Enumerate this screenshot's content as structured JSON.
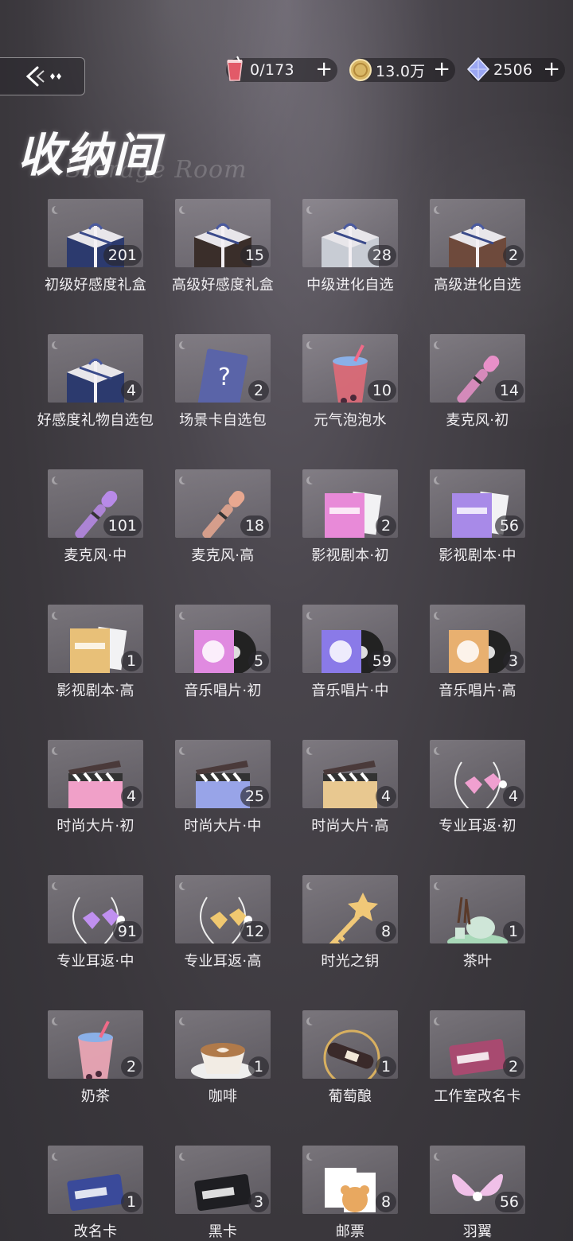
{
  "header": {
    "title": "收纳间",
    "subtitle": "Storage Room",
    "back_icon": "back-arrow-icon"
  },
  "resources": [
    {
      "icon": "drink-icon",
      "value": "0/173",
      "color": "#e05a6a"
    },
    {
      "icon": "gold-coin-icon",
      "value": "13.0万",
      "color": "#e8c87a"
    },
    {
      "icon": "diamond-icon",
      "value": "2506",
      "color": "#9aa6f2"
    }
  ],
  "items": [
    {
      "name": "初级好感度礼盒",
      "count": "201",
      "icon": "gift-box-blue-icon",
      "color": "#2c3a6e"
    },
    {
      "name": "高级好感度礼盒",
      "count": "15",
      "icon": "gift-set-premium-icon",
      "color": "#3a2e2a"
    },
    {
      "name": "中级进化自选",
      "count": "28",
      "icon": "box-silver-icon",
      "color": "#c8ccd4"
    },
    {
      "name": "高级进化自选",
      "count": "2",
      "icon": "box-brown-icon",
      "color": "#6e4a3c"
    },
    {
      "name": "好感度礼物自选包",
      "count": "4",
      "icon": "gift-box-blue-icon",
      "color": "#2c3a6e"
    },
    {
      "name": "场景卡自选包",
      "count": "2",
      "icon": "scene-card-icon",
      "color": "#5a64a8"
    },
    {
      "name": "元气泡泡水",
      "count": "10",
      "icon": "bubble-drink-icon",
      "color": "#e06a78"
    },
    {
      "name": "麦克风·初",
      "count": "14",
      "icon": "microphone-pink-icon",
      "color": "#e890c8"
    },
    {
      "name": "麦克风·中",
      "count": "101",
      "icon": "microphone-purple-icon",
      "color": "#b88ae8"
    },
    {
      "name": "麦克风·高",
      "count": "18",
      "icon": "microphone-peach-icon",
      "color": "#e8a890"
    },
    {
      "name": "影视剧本·初",
      "count": "2",
      "icon": "script-pink-icon",
      "color": "#e88ad8"
    },
    {
      "name": "影视剧本·中",
      "count": "56",
      "icon": "script-purple-icon",
      "color": "#a88ae8"
    },
    {
      "name": "影视剧本·高",
      "count": "1",
      "icon": "script-gold-icon",
      "color": "#e8c078"
    },
    {
      "name": "音乐唱片·初",
      "count": "5",
      "icon": "record-pink-icon",
      "color": "#e08ae0"
    },
    {
      "name": "音乐唱片·中",
      "count": "59",
      "icon": "record-purple-icon",
      "color": "#8a7ae8"
    },
    {
      "name": "音乐唱片·高",
      "count": "3",
      "icon": "record-gold-icon",
      "color": "#e8b070"
    },
    {
      "name": "时尚大片·初",
      "count": "4",
      "icon": "clapperboard-pink-icon",
      "color": "#f0a0c8"
    },
    {
      "name": "时尚大片·中",
      "count": "25",
      "icon": "clapperboard-blue-icon",
      "color": "#98a4e8"
    },
    {
      "name": "时尚大片·高",
      "count": "4",
      "icon": "clapperboard-gold-icon",
      "color": "#e8c890"
    },
    {
      "name": "专业耳返·初",
      "count": "4",
      "icon": "earphones-pink-icon",
      "color": "#f0a0d0"
    },
    {
      "name": "专业耳返·中",
      "count": "91",
      "icon": "earphones-purple-icon",
      "color": "#c090f0"
    },
    {
      "name": "专业耳返·高",
      "count": "12",
      "icon": "earphones-gold-icon",
      "color": "#f0c870"
    },
    {
      "name": "时光之钥",
      "count": "8",
      "icon": "star-key-icon",
      "color": "#f0c878"
    },
    {
      "name": "茶叶",
      "count": "1",
      "icon": "tea-set-icon",
      "color": "#a8d8b8"
    },
    {
      "name": "奶茶",
      "count": "2",
      "icon": "milk-tea-icon",
      "color": "#f0a8b8"
    },
    {
      "name": "咖啡",
      "count": "1",
      "icon": "coffee-cup-icon",
      "color": "#f2ece4"
    },
    {
      "name": "葡萄酿",
      "count": "1",
      "icon": "wine-bottle-icon",
      "color": "#3a2a2a"
    },
    {
      "name": "工作室改名卡",
      "count": "2",
      "icon": "rename-card-pink-icon",
      "color": "#a84a70"
    },
    {
      "name": "改名卡",
      "count": "1",
      "icon": "rename-card-blue-icon",
      "color": "#3a4a9a"
    },
    {
      "name": "黑卡",
      "count": "3",
      "icon": "black-card-icon",
      "color": "#1e1e22"
    },
    {
      "name": "邮票",
      "count": "8",
      "icon": "bear-stamps-icon",
      "color": "#e8a860"
    },
    {
      "name": "羽翼",
      "count": "56",
      "icon": "wings-icon",
      "color": "#f0c0e8"
    }
  ]
}
